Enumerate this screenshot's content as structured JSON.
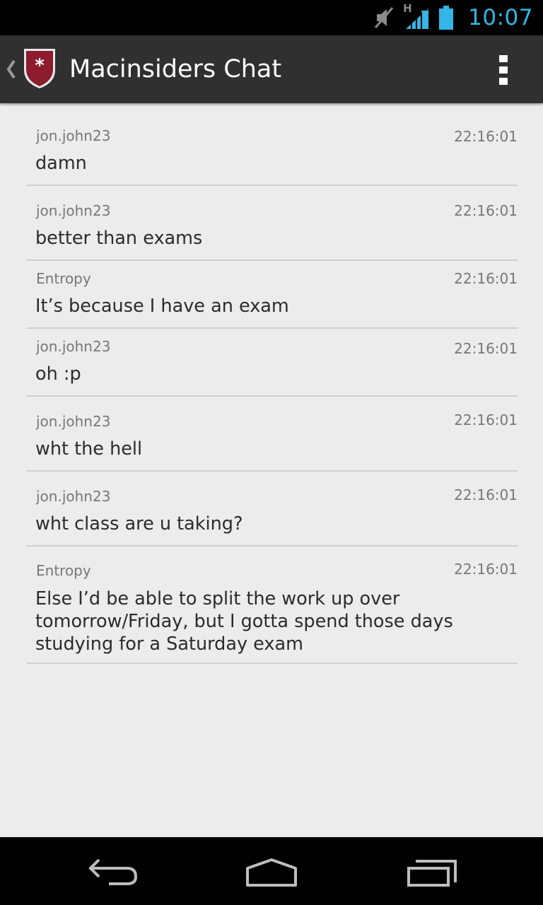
{
  "status_bar": {
    "time": "10:07",
    "network_type": "H",
    "icons": [
      "mute-icon",
      "signal-icon",
      "battery-icon"
    ],
    "accent_color": "#33b5e5"
  },
  "action_bar": {
    "title": "Macinsiders Chat",
    "logo_color": "#8c1c2e",
    "icons": [
      "up-caret-icon",
      "app-logo-icon",
      "overflow-menu-icon"
    ]
  },
  "messages": [
    {
      "author": "jon.john23",
      "time": "22:16:01",
      "text": "damn"
    },
    {
      "author": "jon.john23",
      "time": "22:16:01",
      "text": "better than exams"
    },
    {
      "author": "Entropy",
      "time": "22:16:01",
      "text": "It’s because I have an exam"
    },
    {
      "author": "jon.john23",
      "time": "22:16:01",
      "text": "oh :p"
    },
    {
      "author": "jon.john23",
      "time": "22:16:01",
      "text": "wht the hell"
    },
    {
      "author": "jon.john23",
      "time": "22:16:01",
      "text": "wht class are u taking?"
    },
    {
      "author": "Entropy",
      "time": "22:16:01",
      "text": "Else I’d be able to split the work up over tomorrow/Friday, but I gotta spend those days studying for a Saturday exam"
    }
  ],
  "nav_bar": {
    "icons": [
      "back-icon",
      "home-icon",
      "recent-apps-icon"
    ]
  }
}
